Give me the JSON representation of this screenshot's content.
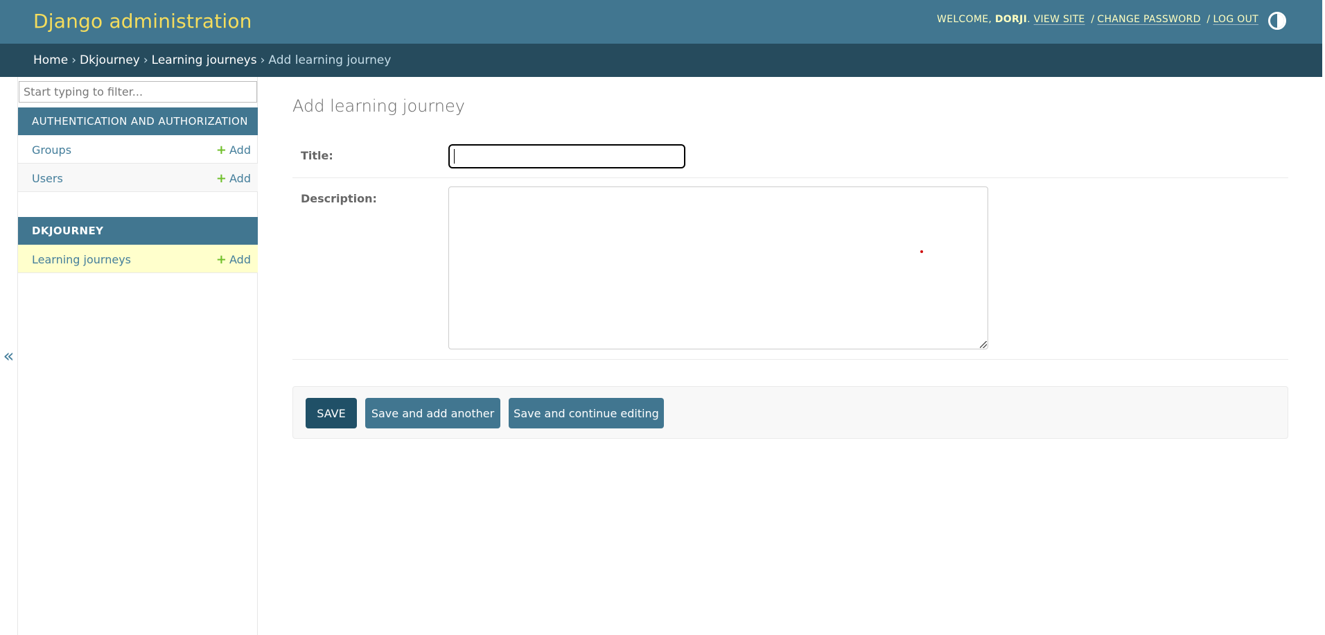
{
  "header": {
    "brand": "Django administration",
    "welcome": "WELCOME,",
    "username": "DORJI",
    "username_suffix": ".",
    "view_site": "VIEW SITE",
    "change_password": "CHANGE PASSWORD",
    "log_out": "LOG OUT",
    "separator": "/",
    "theme_icon": "theme-toggle-icon"
  },
  "breadcrumbs": {
    "items": [
      "Home",
      "Dkjourney",
      "Learning journeys"
    ],
    "current": "Add learning journey",
    "arrow": "›"
  },
  "sidebar": {
    "collapse_icon": "«",
    "filter_placeholder": "Start typing to filter...",
    "modules": [
      {
        "caption": "AUTHENTICATION AND AUTHORIZATION",
        "models": [
          {
            "name": "Groups",
            "add_label": "Add"
          },
          {
            "name": "Users",
            "add_label": "Add"
          }
        ]
      },
      {
        "caption": "DKJOURNEY",
        "models": [
          {
            "name": "Learning journeys",
            "add_label": "Add",
            "selected": true
          }
        ]
      }
    ],
    "plus_icon": "+"
  },
  "main": {
    "title": "Add learning journey",
    "fields": {
      "title_label": "Title:",
      "title_value": "",
      "description_label": "Description:",
      "description_value": ""
    },
    "buttons": {
      "save": "SAVE",
      "save_add_another": "Save and add another",
      "save_continue": "Save and continue editing"
    }
  },
  "colors": {
    "header_bg": "#417690",
    "breadcrumb_bg": "#264b5d",
    "brand": "#f5dd5d",
    "link": "#447e9b",
    "add_plus": "#70bf2b",
    "selected_row": "#ffffcc",
    "save_button": "#205067"
  }
}
